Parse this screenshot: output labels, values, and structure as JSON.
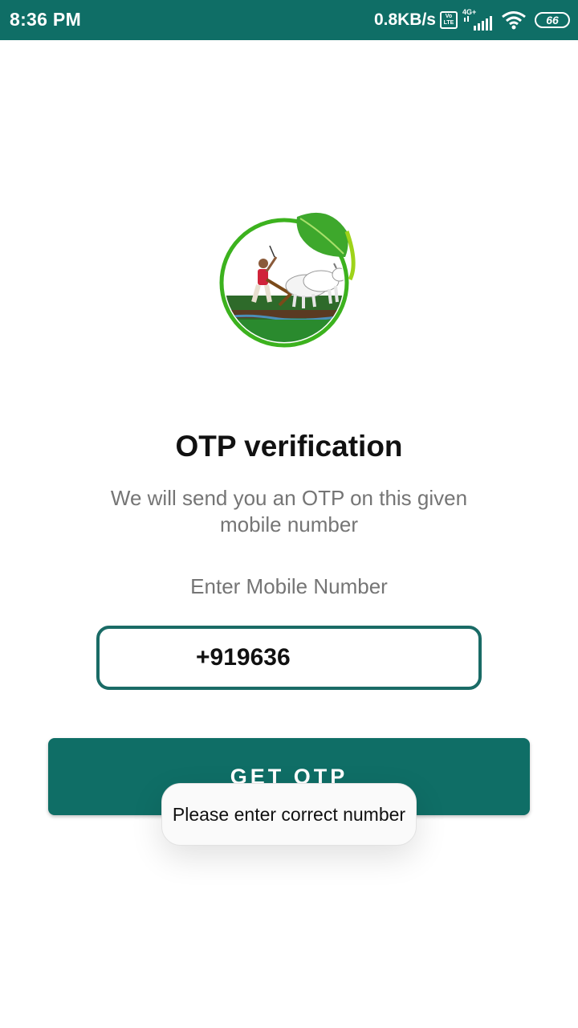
{
  "status_bar": {
    "time": "8:36 PM",
    "net_speed": "0.8KB/s",
    "volte_top": "Vo",
    "volte_bottom": "LTE",
    "network_type": "4G+",
    "battery": "66",
    "background_color": "#0f6e66"
  },
  "logo": {
    "icon": "farmer-plowing-logo-icon"
  },
  "main": {
    "title": "OTP verification",
    "subtitle": "We will send you an OTP on this given mobile number",
    "input_label": "Enter Mobile Number",
    "phone_value": "+919636",
    "button_label": "GET OTP",
    "accent_color": "#0f6e66"
  },
  "toast": {
    "message": "Please enter correct number"
  }
}
